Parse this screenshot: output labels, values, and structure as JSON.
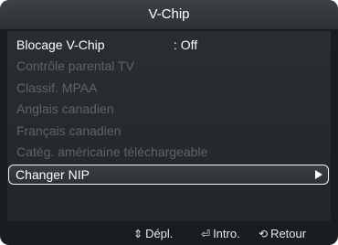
{
  "title": "V-Chip",
  "menu": {
    "items": [
      {
        "label": "Blocage V-Chip",
        "value": ": Off",
        "enabled": true,
        "selected": false
      },
      {
        "label": "Contrôle parental TV",
        "value": "",
        "enabled": false,
        "selected": false
      },
      {
        "label": "Classif. MPAA",
        "value": "",
        "enabled": false,
        "selected": false
      },
      {
        "label": "Anglais canadien",
        "value": "",
        "enabled": false,
        "selected": false
      },
      {
        "label": "Français canadien",
        "value": "",
        "enabled": false,
        "selected": false
      },
      {
        "label": "Catég. américaine téléchargeable",
        "value": "",
        "enabled": false,
        "selected": false
      },
      {
        "label": "Changer NIP",
        "value": "",
        "enabled": true,
        "selected": true,
        "icon": "arrow-right-icon"
      }
    ]
  },
  "footer": {
    "move": {
      "icon": "updown-icon",
      "glyph": "⇕",
      "label": "Dépl."
    },
    "enter": {
      "icon": "enter-icon",
      "glyph": "⏎",
      "label": "Intro."
    },
    "return": {
      "icon": "return-icon",
      "glyph": "⟲",
      "label": "Retour"
    }
  }
}
